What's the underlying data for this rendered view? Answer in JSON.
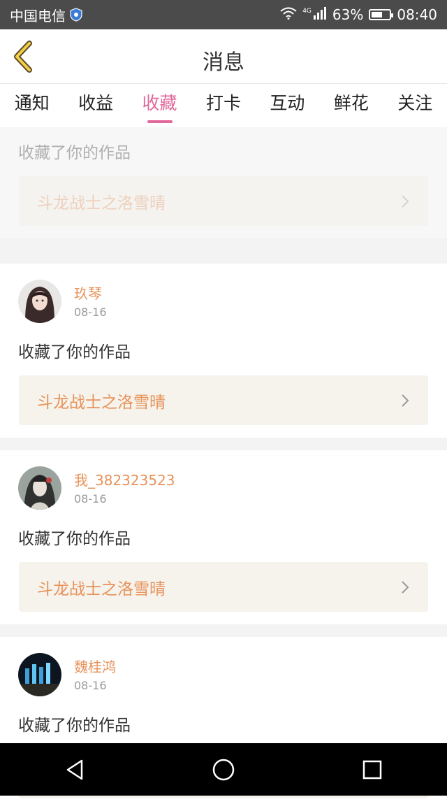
{
  "status_bar": {
    "carrier": "中国电信",
    "network": "4G",
    "battery": "63%",
    "battery_level": 0.63,
    "time": "08:40"
  },
  "header": {
    "title": "消息"
  },
  "tabs": [
    {
      "label": "通知",
      "active": false
    },
    {
      "label": "收益",
      "active": false
    },
    {
      "label": "收藏",
      "active": true
    },
    {
      "label": "打卡",
      "active": false
    },
    {
      "label": "互动",
      "active": false
    },
    {
      "label": "鲜花",
      "active": false
    },
    {
      "label": "关注",
      "active": false
    }
  ],
  "messages": [
    {
      "action": "收藏了你的作品",
      "work": "斗龙战士之洛雪晴"
    },
    {
      "user": "玖琴",
      "date": "08-16",
      "action": "收藏了你的作品",
      "work": "斗龙战士之洛雪晴"
    },
    {
      "user": "我_382323523",
      "date": "08-16",
      "action": "收藏了你的作品",
      "work": "斗龙战士之洛雪晴"
    },
    {
      "user": "魏桂鸿",
      "date": "08-16",
      "action": "收藏了你的作品"
    }
  ],
  "colors": {
    "accent": "#e0689b",
    "name": "#e8925a",
    "work_bg": "#f5f3ec"
  }
}
